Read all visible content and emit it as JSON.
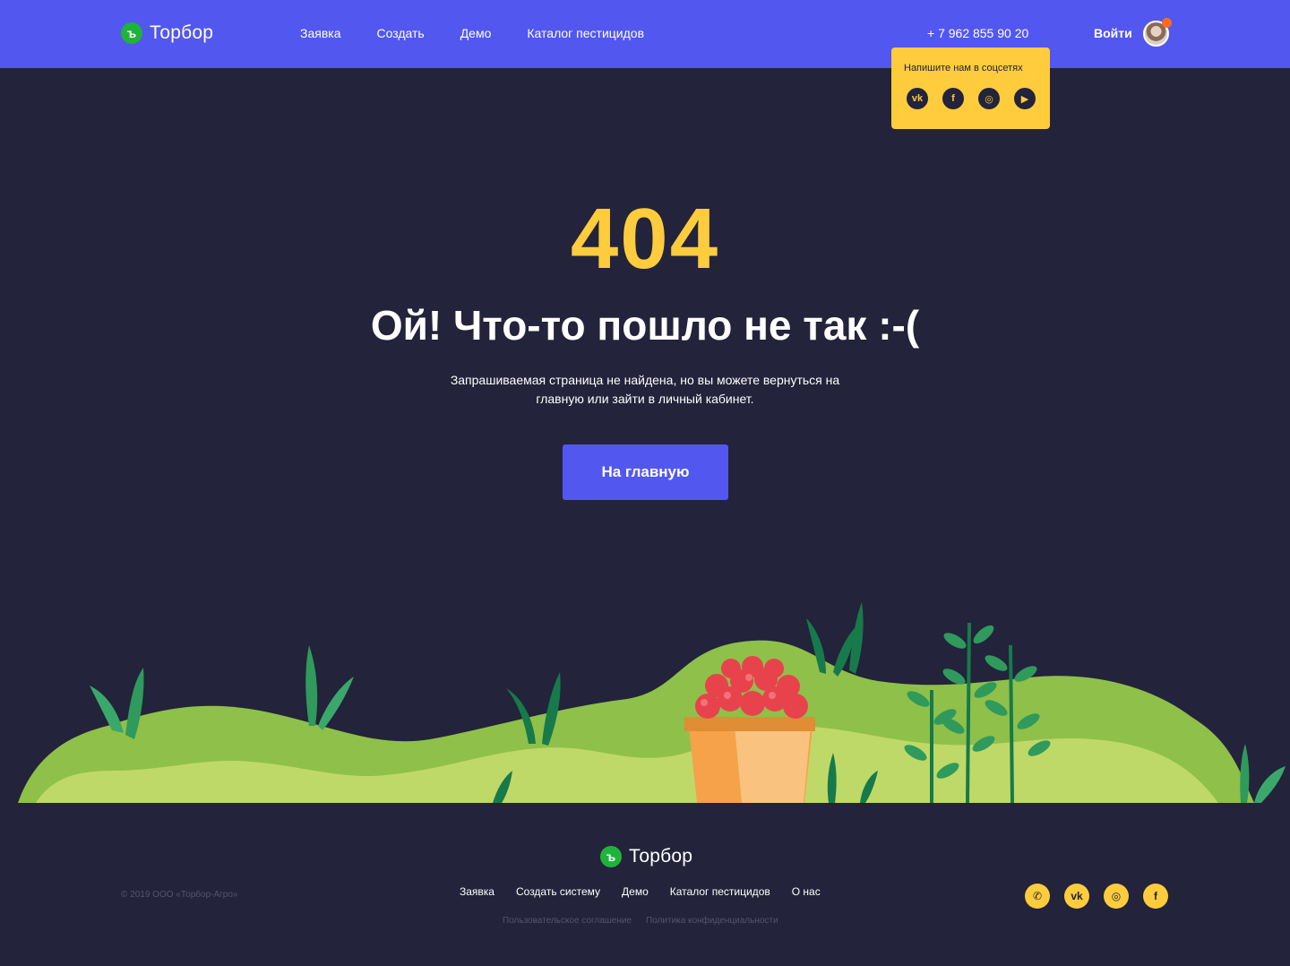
{
  "header": {
    "brand": "Торбор",
    "logo_mark": "ъ",
    "nav": [
      "Заявка",
      "Создать",
      "Демо",
      "Каталог пестицидов"
    ],
    "phone": "+ 7 962 855 90 20",
    "login": "Войти"
  },
  "social_popover": {
    "title": "Напишите нам в соцсетях",
    "icons": [
      {
        "name": "vk-icon",
        "glyph": "vk"
      },
      {
        "name": "facebook-icon",
        "glyph": "f"
      },
      {
        "name": "instagram-icon",
        "glyph": "◎"
      },
      {
        "name": "youtube-icon",
        "glyph": "▶"
      }
    ]
  },
  "main": {
    "code": "404",
    "headline": "Ой! Что-то пошло не так :-(",
    "description": "Запрашиваемая страница не найдена, но вы можете вернуться на главную или зайти в личный кабинет.",
    "button": "На главную"
  },
  "footer": {
    "brand": "Торбор",
    "logo_mark": "ъ",
    "copyright": "© 2019 ООО «Торбор-Агро»",
    "nav": [
      "Заявка",
      "Создать систему",
      "Демо",
      "Каталог пестицидов",
      "О нас"
    ],
    "legal": [
      "Пользовательское соглашение",
      "Политика конфиденциальности"
    ],
    "icons": [
      {
        "name": "viber-icon",
        "glyph": "✆"
      },
      {
        "name": "vk-icon",
        "glyph": "vk"
      },
      {
        "name": "instagram-icon",
        "glyph": "◎"
      },
      {
        "name": "facebook-icon",
        "glyph": "f"
      }
    ]
  },
  "colors": {
    "header_bg": "#5257f0",
    "page_bg": "#23233b",
    "accent_yellow": "#fecc3c",
    "brand_green": "#1fb33c"
  }
}
